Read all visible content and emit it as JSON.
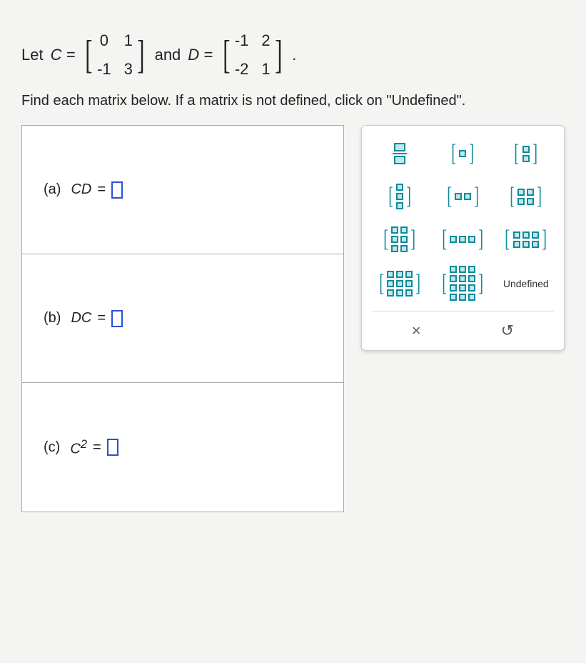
{
  "problem": {
    "let": "Let",
    "c_eq": "C =",
    "and": "and",
    "d_eq": "D =",
    "period": ".",
    "c_matrix": [
      [
        "0",
        "1"
      ],
      [
        "-1",
        "3"
      ]
    ],
    "d_matrix": [
      [
        "-1",
        "2"
      ],
      [
        "-2",
        "1"
      ]
    ],
    "instruction": "Find each matrix below. If a matrix is not defined, click on \"Undefined\"."
  },
  "parts": {
    "a": {
      "label": "(a)",
      "expr": "CD",
      "eq": "="
    },
    "b": {
      "label": "(b)",
      "expr": "DC",
      "eq": "="
    },
    "c": {
      "label": "(c)",
      "expr_base": "C",
      "expr_exp": "2",
      "eq": "="
    }
  },
  "palette": {
    "undefined": "Undefined",
    "close": "×",
    "reset": "↺"
  }
}
